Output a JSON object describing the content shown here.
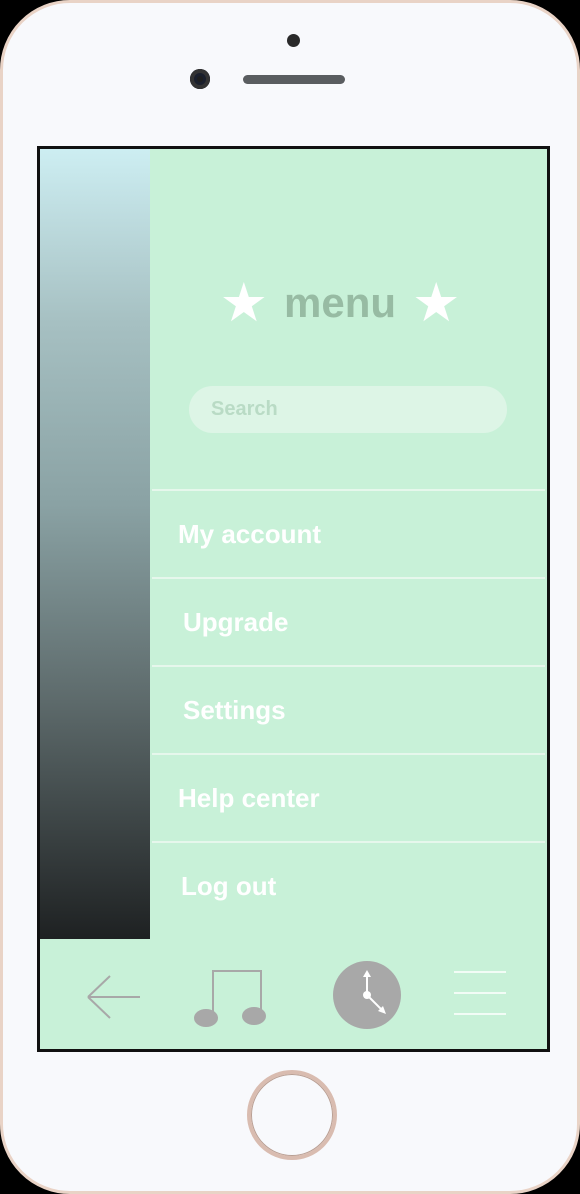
{
  "menu": {
    "title": "menu",
    "star_left": "★",
    "star_right": "★"
  },
  "search": {
    "placeholder": "Search"
  },
  "menu_items": [
    {
      "label": "My account"
    },
    {
      "label": "Upgrade"
    },
    {
      "label": "Settings"
    },
    {
      "label": "Help center"
    },
    {
      "label": "Log out"
    }
  ],
  "bottom_nav": [
    {
      "icon": "back-arrow-icon"
    },
    {
      "icon": "music-note-icon"
    },
    {
      "icon": "clock-icon"
    },
    {
      "icon": "hamburger-menu-icon"
    }
  ],
  "colors": {
    "drawer_bg": "#c8f1d8",
    "title_text": "#97bba3",
    "menu_text": "#ffffff",
    "nav_icon": "#a8a8a8",
    "phone_frame": "#e9d3c6"
  }
}
